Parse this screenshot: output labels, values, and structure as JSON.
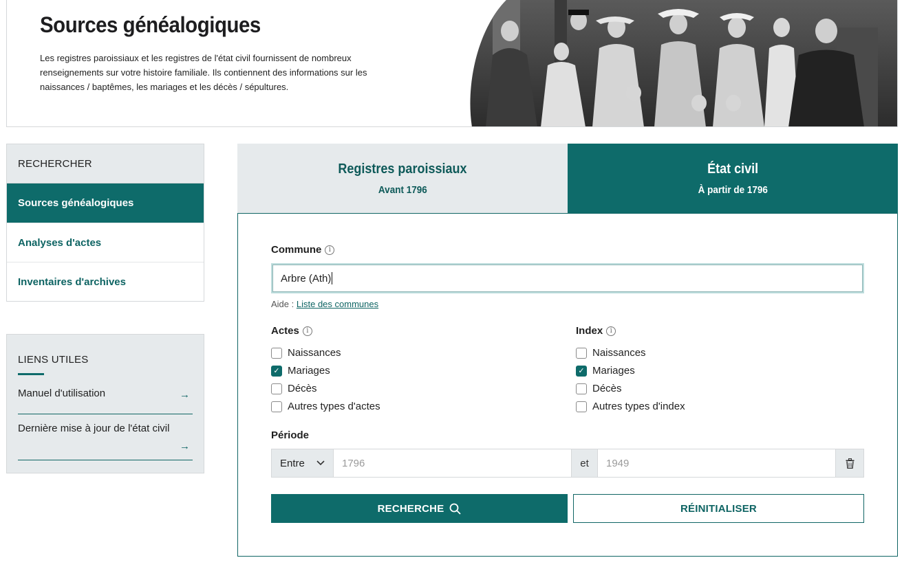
{
  "header": {
    "title": "Sources généalogiques",
    "intro": "Les registres paroissiaux et les registres de l'état civil fournissent de nombreux renseignements sur votre histoire familiale. Ils contiennent des informations sur les naissances / baptêmes, les mariages et les décès / sépultures."
  },
  "sidebar": {
    "heading": "RECHERCHER",
    "items": [
      {
        "label": "Sources généalogiques",
        "active": true
      },
      {
        "label": "Analyses d'actes",
        "active": false
      },
      {
        "label": "Inventaires d'archives",
        "active": false
      }
    ]
  },
  "useful_links": {
    "heading": "LIENS UTILES",
    "items": [
      {
        "label": "Manuel d'utilisation"
      },
      {
        "label": "Dernière mise à jour de l'état civil"
      }
    ]
  },
  "tabs": [
    {
      "title": "Registres paroissiaux",
      "subtitle": "Avant 1796",
      "active": false
    },
    {
      "title": "État civil",
      "subtitle": "À partir de 1796",
      "active": true
    }
  ],
  "form": {
    "commune_label": "Commune",
    "commune_value": "Arbre (Ath)",
    "aide_prefix": "Aide :",
    "aide_link": "Liste des communes",
    "actes_label": "Actes",
    "actes": [
      {
        "label": "Naissances",
        "checked": false
      },
      {
        "label": "Mariages",
        "checked": true
      },
      {
        "label": "Décès",
        "checked": false
      },
      {
        "label": "Autres types d'actes",
        "checked": false
      }
    ],
    "index_label": "Index",
    "index": [
      {
        "label": "Naissances",
        "checked": false
      },
      {
        "label": "Mariages",
        "checked": true
      },
      {
        "label": "Décès",
        "checked": false
      },
      {
        "label": "Autres types d'index",
        "checked": false
      }
    ],
    "periode_label": "Période",
    "periode_mode": "Entre",
    "periode_from_placeholder": "1796",
    "periode_and": "et",
    "periode_to_placeholder": "1949",
    "search_button": "RECHERCHE",
    "reset_button": "RÉINITIALISER"
  },
  "icons": {
    "info": "info-icon",
    "search": "search-icon",
    "trash": "trash-icon",
    "arrow": "arrow-right-icon",
    "chevron": "chevron-down-icon",
    "check": "check-icon"
  },
  "colors": {
    "accent": "#0e6b6a",
    "panel_bg": "#e6eaec"
  }
}
